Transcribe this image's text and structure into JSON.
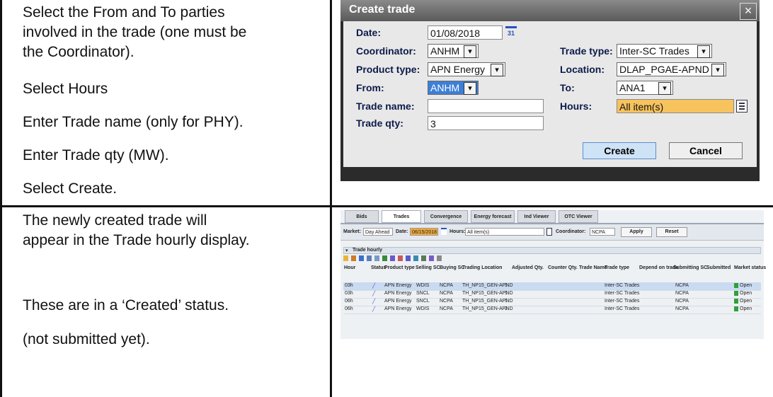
{
  "instructions_top": [
    "Select the From and To parties",
    "involved in the trade (one must be",
    "the Coordinator).",
    "Select Hours",
    "Enter Trade name (only for PHY).",
    "Enter Trade qty (MW).",
    "Select Create."
  ],
  "instructions_bottom": [
    "The newly created trade will",
    "appear in the Trade hourly display.",
    "These are in a ‘Created’ status.",
    "(not submitted yet)."
  ],
  "dialog": {
    "title": "Create trade",
    "close": "×",
    "date_label": "Date:",
    "date_value": "01/08/2018",
    "calendar_day": "31",
    "coordinator_label": "Coordinator:",
    "coordinator_value": "ANHM",
    "trade_type_label": "Trade type:",
    "trade_type_value": "Inter-SC Trades",
    "product_type_label": "Product type:",
    "product_type_value": "APN Energy",
    "location_label": "Location:",
    "location_value": "DLAP_PGAE-APND",
    "from_label": "From:",
    "from_value": "ANHM",
    "to_label": "To:",
    "to_value": "ANA1",
    "trade_name_label": "Trade name:",
    "trade_name_value": "",
    "hours_label": "Hours:",
    "hours_value": "All item(s)",
    "trade_qty_label": "Trade qty:",
    "trade_qty_value": "3",
    "create_button": "Create",
    "cancel_button": "Cancel",
    "chevron": "▾",
    "colors": {
      "hours_bg": "#f7c35e",
      "from_bg": "#3d7fd6",
      "create_bg": "#cfe3f7"
    }
  },
  "trades_screen": {
    "tabs": [
      "Bids",
      "Trades",
      "Convergence Bids",
      "Energy forecast",
      "Ind Viewer",
      "OTC Viewer"
    ],
    "active_tab": "Trades",
    "filter": {
      "market_label": "Market:",
      "market_value": "Day Ahead",
      "date_label": "Date:",
      "date_value": "06/15/2018",
      "hours_label": "Hours:",
      "hours_value": "All item(s)",
      "coordinator_label": "Coordinator:",
      "coordinator_value": "NCPA",
      "apply_button": "Apply",
      "reset_button": "Reset"
    },
    "section_title": "Trade hourly",
    "columns": [
      "Hour",
      "Status",
      "Product type",
      "Selling SC",
      "Buying SC",
      "Trading Location",
      "Adjusted Qty.",
      "Counter Qty.",
      "Trade Name",
      "Trade type",
      "Depend on trade",
      "Submitting SC",
      "Submitted",
      "Market status"
    ],
    "rows": [
      {
        "hour": "03h",
        "product": "APN Energy",
        "selling": "WDIS",
        "buying": "NCPA",
        "location": "TH_NP15_GEN-APND",
        "qty": "1",
        "trade_type": "Inter-SC Trades",
        "submitting": "NCPA",
        "market_status": "Open"
      },
      {
        "hour": "03h",
        "product": "APN Energy",
        "selling": "SNCL",
        "buying": "NCPA",
        "location": "TH_NP15_GEN-APND",
        "qty": "1",
        "trade_type": "Inter-SC Trades",
        "submitting": "NCPA",
        "market_status": "Open"
      },
      {
        "hour": "06h",
        "product": "APN Energy",
        "selling": "SNCL",
        "buying": "NCPA",
        "location": "TH_NP15_GEN-APND",
        "qty": "1",
        "trade_type": "Inter-SC Trades",
        "submitting": "NCPA",
        "market_status": "Open"
      },
      {
        "hour": "06h",
        "product": "APN Energy",
        "selling": "WDIS",
        "buying": "NCPA",
        "location": "TH_NP15_GEN-APND",
        "qty": "2",
        "trade_type": "Inter-SC Trades",
        "submitting": "NCPA",
        "market_status": "Open"
      }
    ],
    "colors": {
      "date_highlight": "#f2a93b",
      "open_lock": "#2fa03a"
    }
  }
}
